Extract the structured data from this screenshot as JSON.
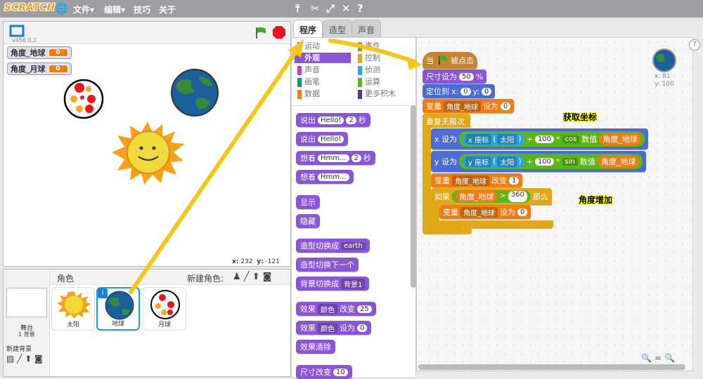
{
  "menubar": {
    "logo": "SCRATCH",
    "file": "文件▾",
    "edit": "编辑▾",
    "tips": "技巧",
    "about": "关于"
  },
  "stage": {
    "version": "v456.0.2",
    "var1_name": "角度_地球",
    "var1_val": "0",
    "var2_name": "角度_月球",
    "var2_val": "0",
    "x_label": "x:",
    "x_val": "232",
    "y_label": "y:",
    "y_val": "-121"
  },
  "sprites": {
    "header": "角色",
    "new_sprite": "新建角色:",
    "stage_label": "舞台",
    "stage_count": "1 背景",
    "new_bg": "新建背景",
    "items": [
      "太阳",
      "地球",
      "月球"
    ]
  },
  "tabs": [
    "程序",
    "造型",
    "声音"
  ],
  "categories": {
    "left": [
      "运动",
      "外观",
      "声音",
      "画笔",
      "数据"
    ],
    "right": [
      "事件",
      "控制",
      "侦测",
      "运算",
      "更多积木"
    ]
  },
  "palette": {
    "say_secs": [
      "说出",
      "Hello!",
      "2",
      "秒"
    ],
    "say": [
      "说出",
      "Hello!"
    ],
    "think_secs": [
      "想着",
      "Hmm...",
      "2",
      "秒"
    ],
    "think": [
      "想着",
      "Hmm..."
    ],
    "show": "显示",
    "hide": "隐藏",
    "switch_costume": [
      "造型切换成",
      "earth"
    ],
    "next_costume": "造型切换下一个",
    "switch_bg": [
      "背景切换成",
      "背景1"
    ],
    "change_effect": [
      "效果",
      "颜色",
      "改变",
      "25"
    ],
    "set_effect": [
      "效果",
      "颜色",
      "设为",
      "0"
    ],
    "clear_effects": "效果清除",
    "change_size": [
      "尺寸改变",
      "10"
    ]
  },
  "script": {
    "hat": [
      "当",
      "被点击"
    ],
    "set_size": [
      "尺寸设为",
      "50",
      "%"
    ],
    "goto": [
      "定位到",
      "x:",
      "0",
      "y:",
      "0"
    ],
    "set_var": [
      "变量",
      "角度_地球",
      "设为",
      "0"
    ],
    "forever": "重复无限次",
    "set_x": [
      "x 设为",
      "x 座标",
      "(",
      "太阳",
      ")",
      "+",
      "100",
      "*",
      "cos",
      "数值",
      "角度_地球"
    ],
    "set_y": [
      "y 设为",
      "y 座标",
      "(",
      "太阳",
      ")",
      "+",
      "100",
      "*",
      "sin",
      "数值",
      "角度_地球"
    ],
    "change_var": [
      "变量",
      "角度_地球",
      "改变",
      "1"
    ],
    "if": [
      "如果",
      "角度_地球",
      ">",
      "360",
      "那么"
    ],
    "inner_set": [
      "变量",
      "角度_地球",
      "设为",
      "0"
    ],
    "xy_x": "x: 81",
    "xy_y": "y: 100"
  },
  "annotations": {
    "coord": "获取坐标",
    "angle": "角度增加"
  },
  "colors": {
    "events": "#c88330",
    "looks": "#8a55d7",
    "motion": "#4a6cd4",
    "data": "#ee7d16",
    "control": "#e1a91a",
    "sensing": "#2ca5e2",
    "operators": "#5cb712",
    "arrow": "#f5c518"
  }
}
